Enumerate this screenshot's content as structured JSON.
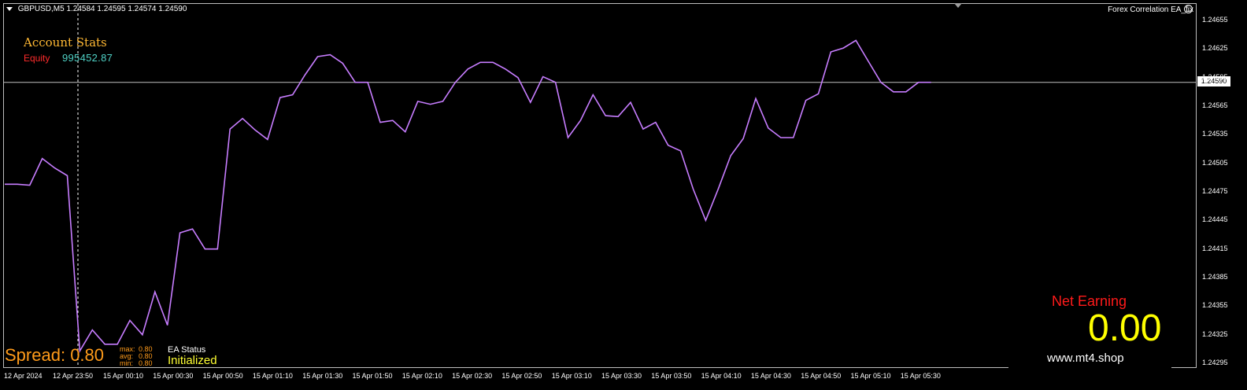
{
  "header": {
    "symbol": "GBPUSD,M5",
    "ohlc": "1.24584 1.24595 1.24574 1.24590",
    "ea_name": "Forex Correlation EA_fix"
  },
  "icons": {
    "dropdown": "triangle-down-icon",
    "ea_smiley": "smiley-face-icon",
    "shift_marker": "triangle-down-icon"
  },
  "account_stats": {
    "title": "Account Stats",
    "equity_label": "Equity",
    "equity_value": "995452.87"
  },
  "spread": {
    "label": "Spread:",
    "value": "0.80",
    "max_label": "max:",
    "max_value": "0.80",
    "avg_label": "avg:",
    "avg_value": "0.80",
    "min_label": "min:",
    "min_value": "0.80"
  },
  "ea_status": {
    "label": "EA Status",
    "value": "Initialized"
  },
  "net_earning": {
    "label": "Net Earning",
    "value": "0.00",
    "website": "www.mt4.shop"
  },
  "current_price": "1.24590",
  "colors": {
    "line": "#c77dff",
    "background": "#000000",
    "spread": "#ff9b1a",
    "net_earning_label": "#ff1a1a",
    "net_earning_value": "#ffff00",
    "account_title": "#ffb833",
    "equity_label": "#ff2b2b",
    "equity_value": "#4fd1c5",
    "status_value": "#ffff33"
  },
  "chart_data": {
    "type": "line",
    "title": "",
    "xlabel": "",
    "ylabel": "",
    "ylim": [
      1.24285,
      1.24675
    ],
    "yticks": [
      "1.24655",
      "1.24625",
      "1.24595",
      "1.24565",
      "1.24535",
      "1.24505",
      "1.24475",
      "1.24445",
      "1.24415",
      "1.24385",
      "1.24355",
      "1.24325",
      "1.24295"
    ],
    "xticks": [
      "12 Apr 2024",
      "12 Apr 23:50",
      "15 Apr 00:10",
      "15 Apr 00:30",
      "15 Apr 00:50",
      "15 Apr 01:10",
      "15 Apr 01:30",
      "15 Apr 01:50",
      "15 Apr 02:10",
      "15 Apr 02:30",
      "15 Apr 02:50",
      "15 Apr 03:10",
      "15 Apr 03:30",
      "15 Apr 03:50",
      "15 Apr 04:10",
      "15 Apr 04:30",
      "15 Apr 04:50",
      "15 Apr 05:10",
      "15 Apr 05:30"
    ],
    "series": [
      {
        "values": [
          1.24483,
          1.24483,
          1.24482,
          1.2451,
          1.245,
          1.24492,
          1.24308,
          1.2433,
          1.24315,
          1.24315,
          1.2434,
          1.24325,
          1.2437,
          1.24335,
          1.24432,
          1.24436,
          1.24415,
          1.24415,
          1.24541,
          1.24552,
          1.2454,
          1.2453,
          1.24574,
          1.24577,
          1.24598,
          1.24617,
          1.24619,
          1.2461,
          1.2459,
          1.2459,
          1.24548,
          1.2455,
          1.24538,
          1.2457,
          1.24567,
          1.2457,
          1.2459,
          1.24604,
          1.24611,
          1.24611,
          1.24604,
          1.24595,
          1.24569,
          1.24596,
          1.2459,
          1.24532,
          1.2455,
          1.24577,
          1.24555,
          1.24554,
          1.24569,
          1.24541,
          1.24548,
          1.24524,
          1.24518,
          1.24478,
          1.24445,
          1.24478,
          1.24513,
          1.24531,
          1.24573,
          1.24542,
          1.24532,
          1.24532,
          1.24571,
          1.24578,
          1.24622,
          1.24626,
          1.24634,
          1.24612,
          1.2459,
          1.2458,
          1.2458,
          1.2459,
          1.2459
        ]
      }
    ],
    "current_price": 1.2459,
    "grid": false,
    "legend": "none"
  }
}
